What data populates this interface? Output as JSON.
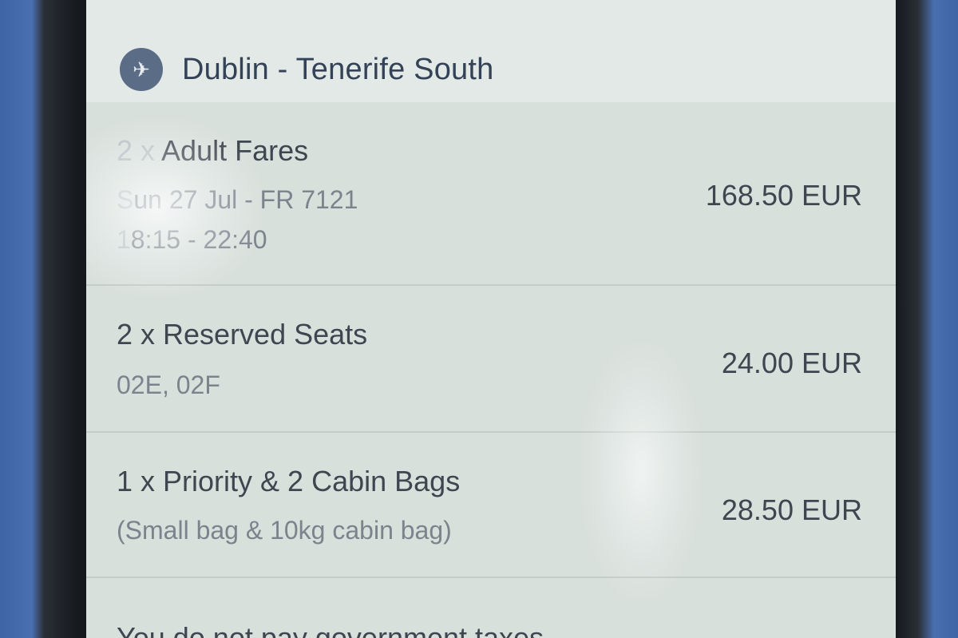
{
  "header": {
    "icon": "plane-icon",
    "route": "Dublin - Tenerife South"
  },
  "items": [
    {
      "quantity_prefix": "2 x",
      "title": "Adult Fares",
      "line1_faded": "S",
      "line1": "un 27 Jul - FR 7121",
      "line2_faded": "1",
      "line2": "8:15 - 22:40",
      "price": "168.50 EUR"
    },
    {
      "title": "2 x Reserved Seats",
      "line1": "02E, 02F",
      "price": "24.00 EUR"
    },
    {
      "title": "1 x Priority & 2 Cabin Bags",
      "line1": "(Small bag & 10kg cabin bag)",
      "price": "28.50 EUR"
    }
  ],
  "footer": {
    "note": "You do not pay government taxes"
  }
}
